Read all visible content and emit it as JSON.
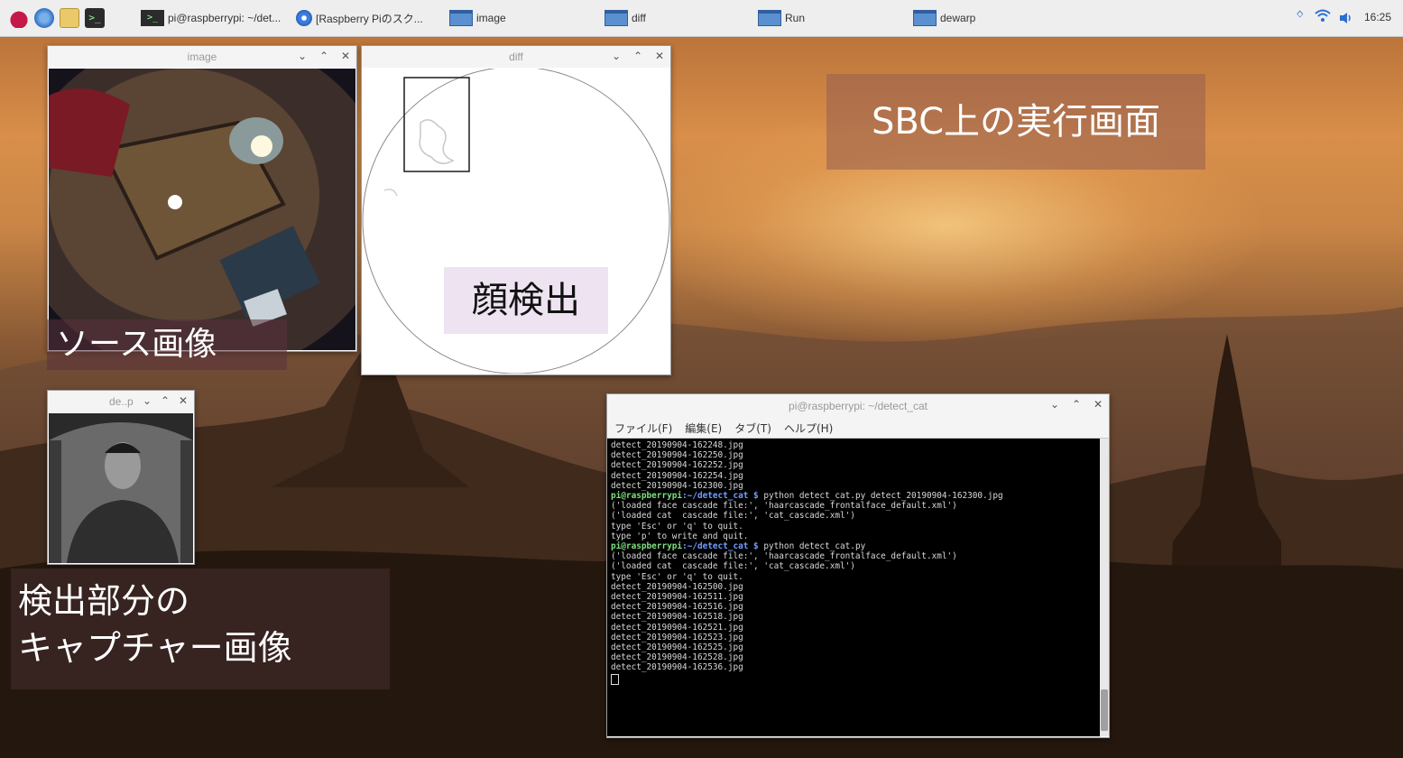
{
  "taskbar": {
    "tasks": [
      {
        "label": "pi@raspberrypi: ~/det..."
      },
      {
        "label": "[Raspberry Piのスク..."
      },
      {
        "label": "image"
      },
      {
        "label": "diff"
      },
      {
        "label": "Run"
      },
      {
        "label": "dewarp"
      }
    ],
    "clock": "16:25"
  },
  "windows": {
    "image": {
      "title": "image"
    },
    "diff": {
      "title": "diff"
    },
    "dewarp": {
      "title": "de..p"
    },
    "terminal": {
      "title": "pi@raspberrypi: ~/detect_cat",
      "menu": [
        "ファイル(F)",
        "編集(E)",
        "タブ(T)",
        "ヘルプ(H)"
      ],
      "lines": [
        {
          "text": "detect_20190904-162248.jpg"
        },
        {
          "text": "detect_20190904-162250.jpg"
        },
        {
          "text": "detect_20190904-162252.jpg"
        },
        {
          "text": "detect_20190904-162254.jpg"
        },
        {
          "text": "detect_20190904-162300.jpg"
        },
        {
          "user": "pi@raspberrypi",
          "dir": ":~/detect_cat $",
          "cmd": " python detect_cat.py detect_20190904-162300.jpg"
        },
        {
          "text": "('loaded face cascade file:', 'haarcascade_frontalface_default.xml')"
        },
        {
          "text": "('loaded cat  cascade file:', 'cat_cascade.xml')"
        },
        {
          "text": "type 'Esc' or 'q' to quit."
        },
        {
          "text": "type 'p' to write and quit."
        },
        {
          "user": "pi@raspberrypi",
          "dir": ":~/detect_cat $",
          "cmd": " python detect_cat.py"
        },
        {
          "text": "('loaded face cascade file:', 'haarcascade_frontalface_default.xml')"
        },
        {
          "text": "('loaded cat  cascade file:', 'cat_cascade.xml')"
        },
        {
          "text": "type 'Esc' or 'q' to quit."
        },
        {
          "text": "detect_20190904-162500.jpg"
        },
        {
          "text": "detect_20190904-162511.jpg"
        },
        {
          "text": "detect_20190904-162516.jpg"
        },
        {
          "text": "detect_20190904-162518.jpg"
        },
        {
          "text": "detect_20190904-162521.jpg"
        },
        {
          "text": "detect_20190904-162523.jpg"
        },
        {
          "text": "detect_20190904-162525.jpg"
        },
        {
          "text": "detect_20190904-162528.jpg"
        },
        {
          "text": "detect_20190904-162536.jpg"
        }
      ]
    }
  },
  "captions": {
    "source_image": "ソース画像",
    "face_detect": "顔検出",
    "sbc_screen": "SBC上の実行画面",
    "capture_line1": "検出部分の",
    "capture_line2": "キャプチャー画像"
  },
  "colors": {
    "taskbar_bg": "#eeeeee",
    "window_icon": "#5a8fd0",
    "terminal_bg": "#000000",
    "prompt_user": "#7fe07f",
    "prompt_dir": "#6f9fff",
    "caption_bg": "rgba(90,50,60,0.55)"
  },
  "icons": [
    "raspberry-menu-icon",
    "web-browser-icon",
    "file-manager-icon",
    "terminal-icon",
    "bluetooth-icon",
    "wifi-icon",
    "volume-icon"
  ]
}
